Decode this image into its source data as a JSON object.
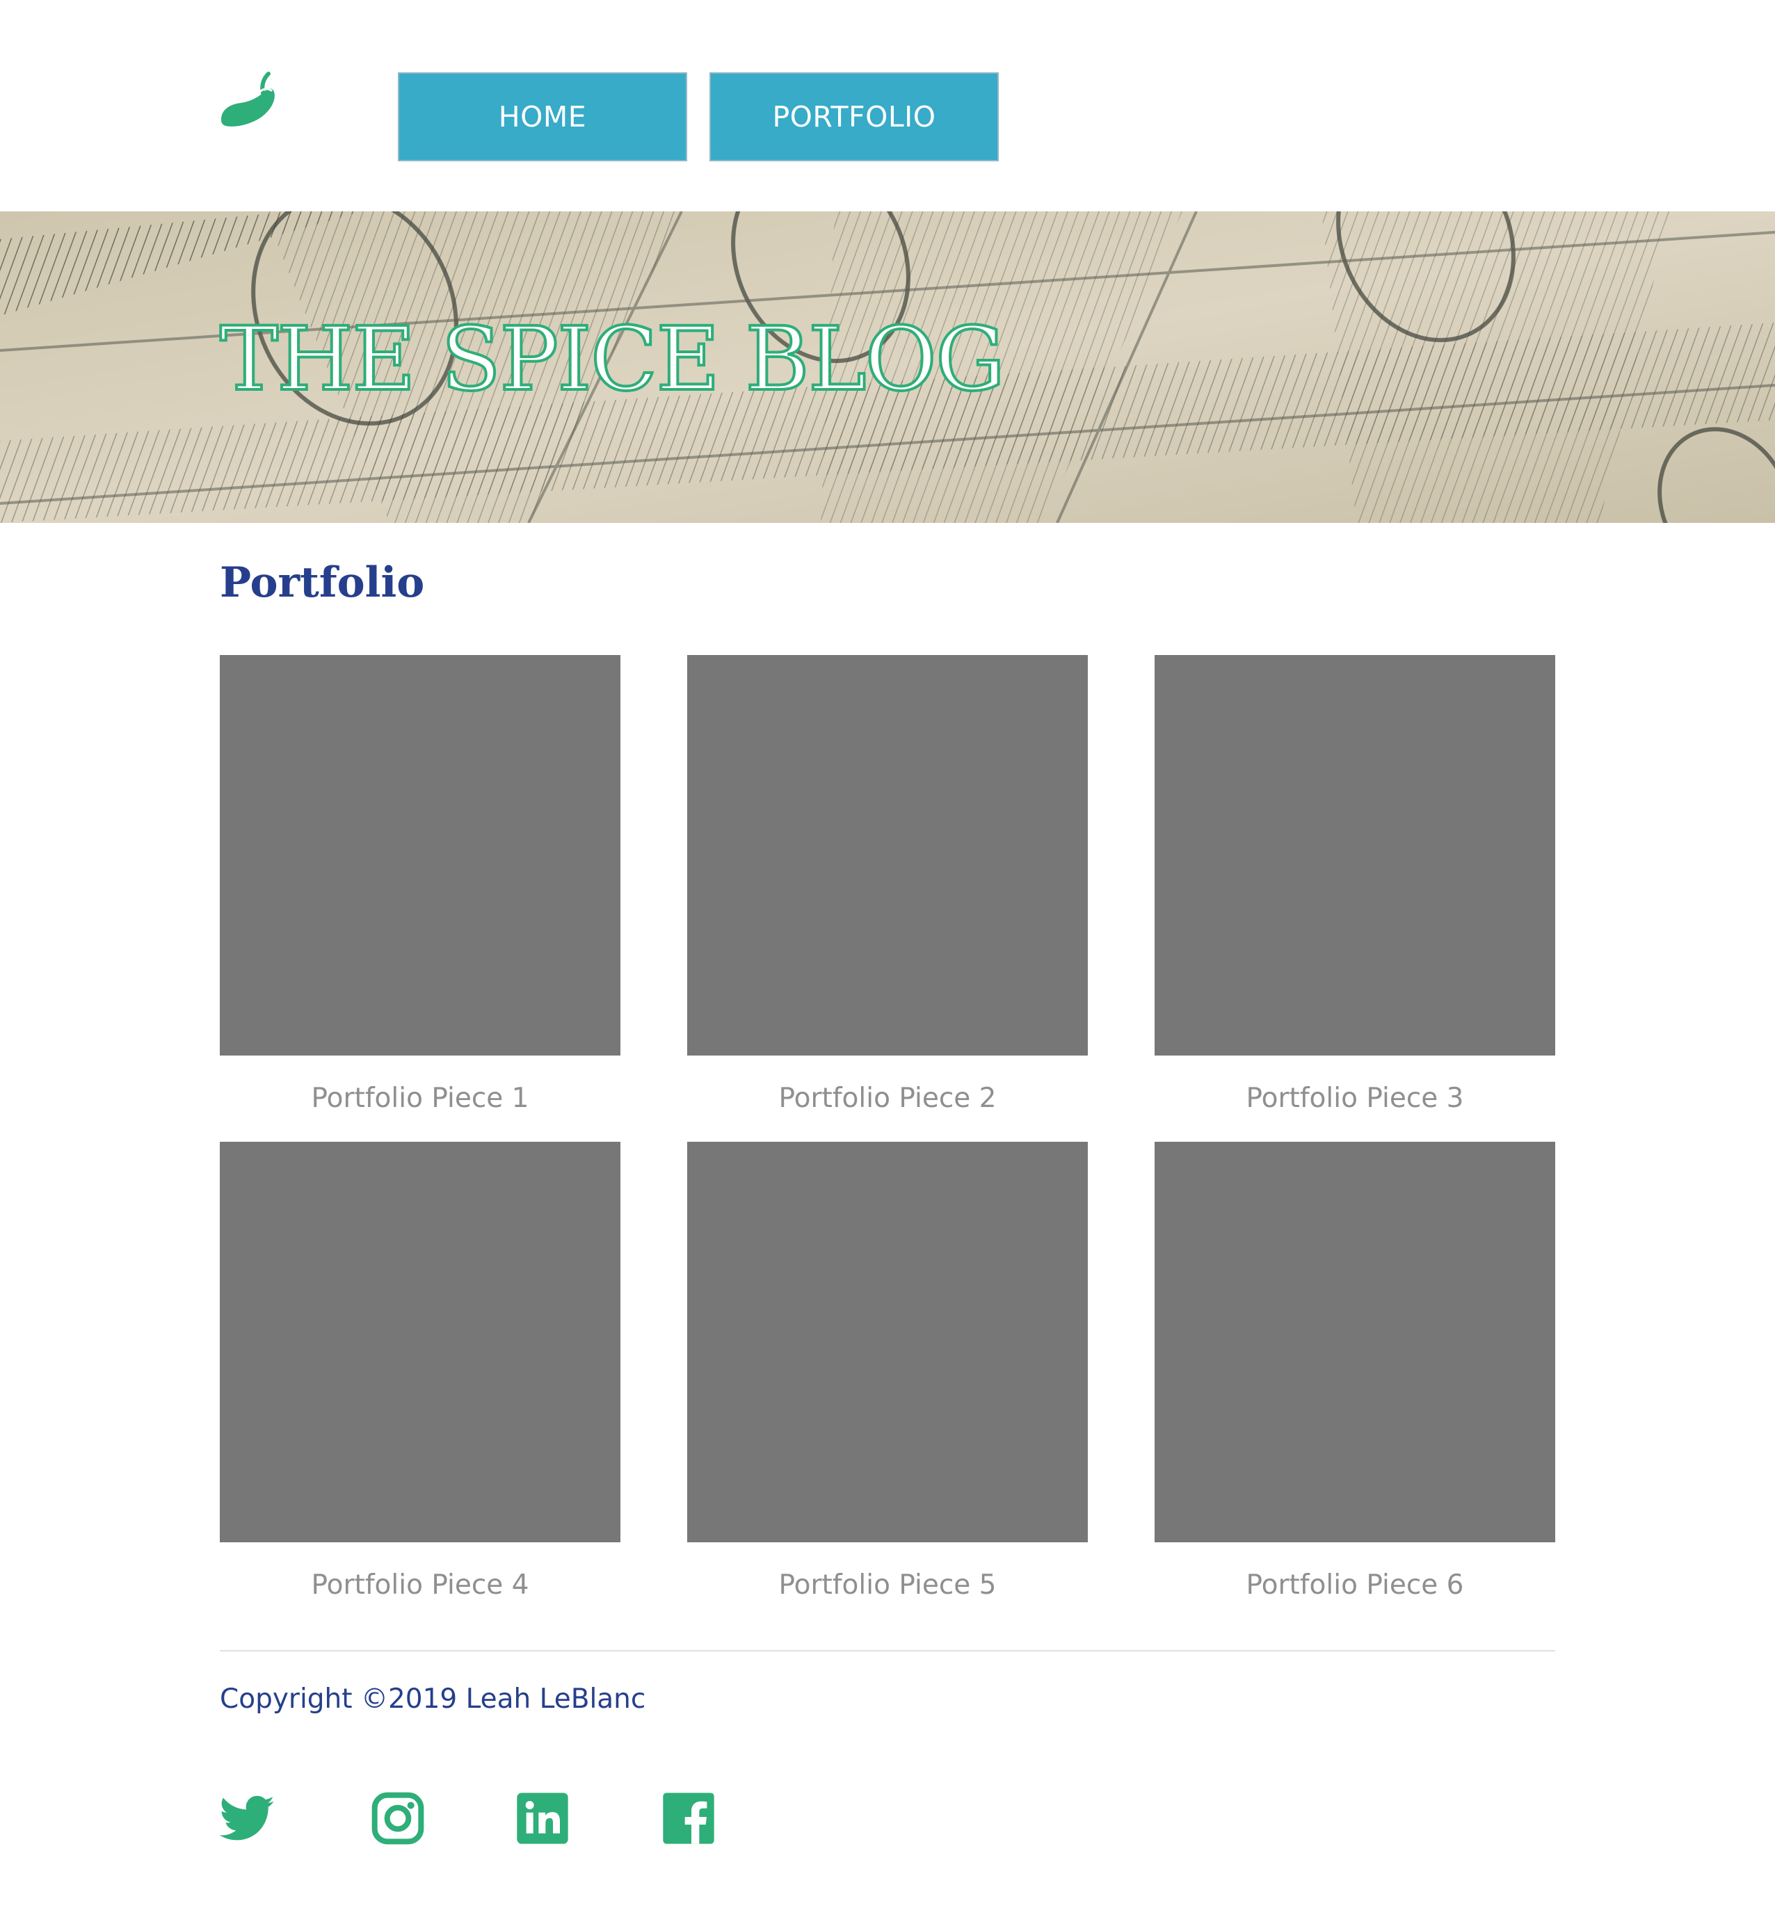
{
  "nav": {
    "logo_icon": "chili-pepper-icon",
    "home_label": "HOME",
    "portfolio_label": "PORTFOLIO"
  },
  "hero": {
    "title": "THE SPICE BLOG",
    "background": "dollar-bills-photo"
  },
  "main": {
    "title": "Portfolio",
    "pieces": [
      {
        "caption": "Portfolio Piece 1"
      },
      {
        "caption": "Portfolio Piece 2"
      },
      {
        "caption": "Portfolio Piece 3"
      },
      {
        "caption": "Portfolio Piece 4"
      },
      {
        "caption": "Portfolio Piece 5"
      },
      {
        "caption": "Portfolio Piece 6"
      }
    ]
  },
  "footer": {
    "copyright": "Copyright ©2019 Leah LeBlanc",
    "social": [
      {
        "icon": "twitter-icon"
      },
      {
        "icon": "instagram-icon"
      },
      {
        "icon": "linkedin-icon"
      },
      {
        "icon": "facebook-icon"
      }
    ]
  },
  "colors": {
    "nav_button": "#37abc8",
    "accent_green": "#2eae78",
    "heading_blue": "#263f8c",
    "tile_gray": "#777777",
    "caption_gray": "#8f8f8f"
  }
}
